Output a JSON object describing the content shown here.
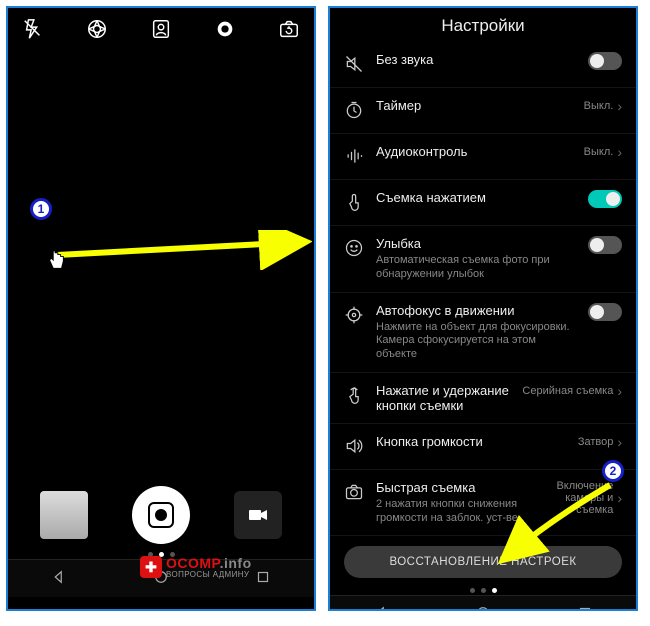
{
  "badges": {
    "one": "1",
    "two": "2"
  },
  "settings": {
    "title": "Настройки",
    "mute": "Без звука",
    "timer": "Таймер",
    "timer_value": "Выкл.",
    "audio": "Аудиоконтроль",
    "audio_value": "Выкл.",
    "touchshot": "Съемка нажатием",
    "smile": "Улыбка",
    "smile_desc": "Автоматическая съемка фото при обнаружении улыбок",
    "af": "Автофокус в движении",
    "af_desc": "Нажмите на объект для фокусировки. Камера сфокусируется на этом объекте",
    "hold": "Нажатие и удержание кнопки съемки",
    "hold_value": "Серийная съемка",
    "vol": "Кнопка громкости",
    "vol_value": "Затвор",
    "quick": "Быстрая съемка",
    "quick_desc": "2 нажатия кнопки снижения громкости на заблок. уст-ве",
    "quick_value": "Включение камеры и съемка",
    "restore": "ВОССТАНОВЛЕНИЕ НАСТРОЕК"
  },
  "watermark": {
    "brand_main": "OCOMP",
    "brand_tail": ".info",
    "subtitle": "ВОПРОСЫ АДМИНУ"
  }
}
